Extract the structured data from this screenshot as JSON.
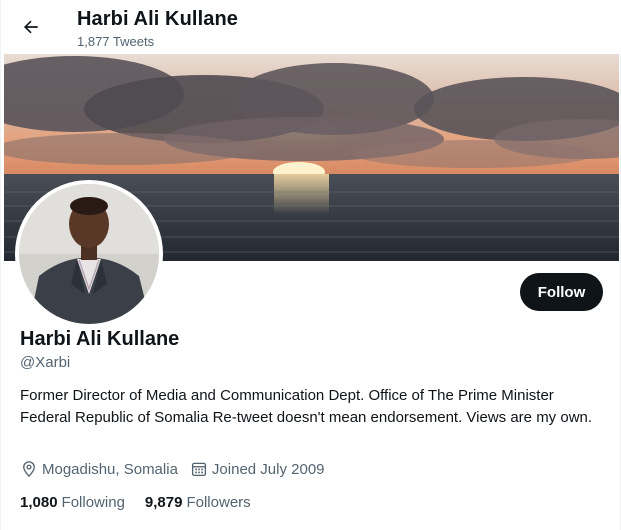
{
  "header": {
    "back_icon": "arrow-left-icon",
    "title": "Harbi Ali Kullane",
    "tweet_count": "1,877 Tweets"
  },
  "profile": {
    "display_name": "Harbi Ali Kullane",
    "handle": "@Xarbi",
    "follow_label": "Follow",
    "bio": "Former Director of Media and Communication Dept. Office of The Prime Minister Federal Republic of Somalia Re-tweet doesn't mean endorsement. Views are my own.",
    "location": "Mogadishu, Somalia",
    "location_icon": "location-pin-icon",
    "joined": "Joined July 2009",
    "joined_icon": "calendar-icon",
    "following_count": "1,080",
    "following_label": "Following",
    "followers_count": "9,879",
    "followers_label": "Followers"
  },
  "colors": {
    "text_primary": "#0f1419",
    "text_secondary": "#536471",
    "follow_button_bg": "#0f1419",
    "follow_button_text": "#ffffff"
  }
}
